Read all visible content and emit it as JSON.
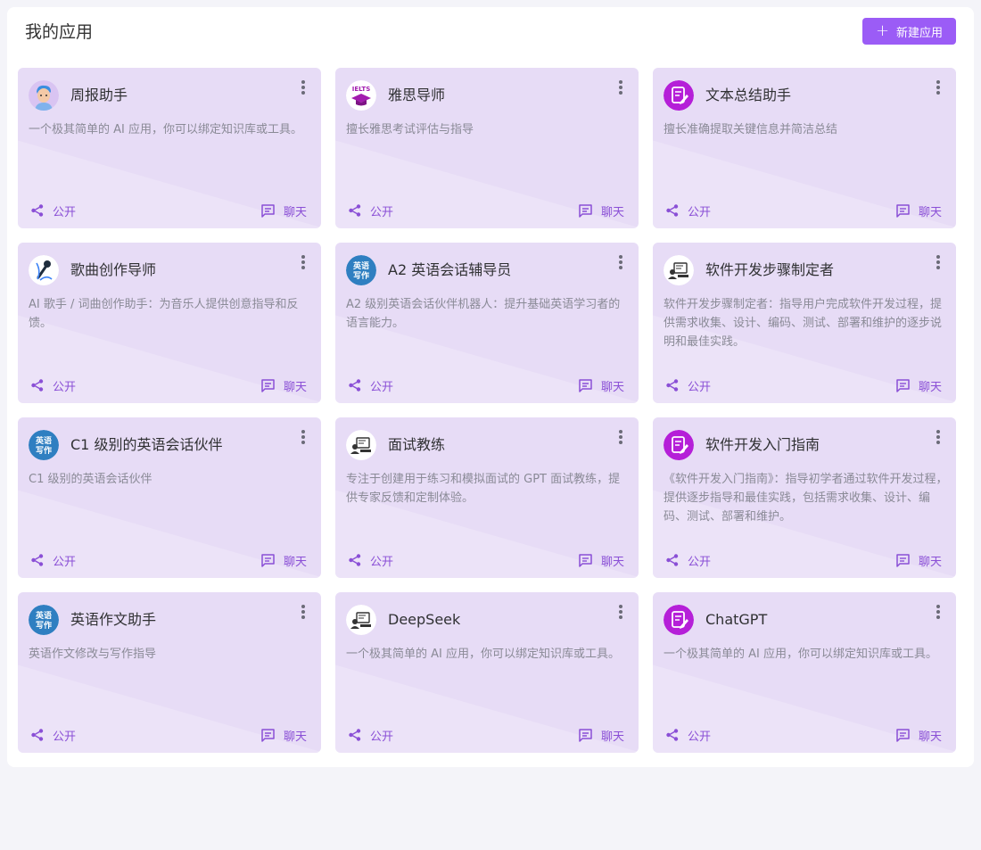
{
  "header": {
    "title": "我的应用",
    "new_button_label": "新建应用",
    "new_button_icon": "plus-icon"
  },
  "colors": {
    "accent": "#9b5cf6",
    "card_bg": "#e7dcf6",
    "action_text": "#8a4fd6"
  },
  "cards": [
    {
      "title": "周报助手",
      "description": "一个极其简单的 AI 应用，你可以绑定知识库或工具。",
      "avatar": "person-avatar",
      "public_label": "公开",
      "chat_label": "聊天"
    },
    {
      "title": "雅思导师",
      "description": "擅长雅思考试评估与指导",
      "avatar": "ielts-avatar",
      "avatar_text": "IELTS",
      "public_label": "公开",
      "chat_label": "聊天"
    },
    {
      "title": "文本总结助手",
      "description": "擅长准确提取关键信息并简洁总结",
      "avatar": "document-edit-avatar",
      "public_label": "公开",
      "chat_label": "聊天"
    },
    {
      "title": "歌曲创作导师",
      "description": "AI 歌手 / 词曲创作助手：为音乐人提供创意指导和反馈。",
      "avatar": "microphone-avatar",
      "public_label": "公开",
      "chat_label": "聊天"
    },
    {
      "title": "A2 英语会话辅导员",
      "description": "A2 级别英语会话伙伴机器人：提升基础英语学习者的语言能力。",
      "avatar": "english-writing-avatar",
      "avatar_text": "英语写作",
      "public_label": "公开",
      "chat_label": "聊天"
    },
    {
      "title": "软件开发步骤制定者",
      "description": "软件开发步骤制定者：指导用户完成软件开发过程，提供需求收集、设计、编码、测试、部署和维护的逐步说明和最佳实践。",
      "avatar": "interview-avatar",
      "public_label": "公开",
      "chat_label": "聊天"
    },
    {
      "title": "C1 级别的英语会话伙伴",
      "description": "C1 级别的英语会话伙伴",
      "avatar": "english-writing-avatar",
      "avatar_text": "英语写作",
      "public_label": "公开",
      "chat_label": "聊天"
    },
    {
      "title": "面试教练",
      "description": "专注于创建用于练习和模拟面试的 GPT 面试教练，提供专家反馈和定制体验。",
      "avatar": "interview-avatar",
      "public_label": "公开",
      "chat_label": "聊天"
    },
    {
      "title": "软件开发入门指南",
      "description": "《软件开发入门指南》：指导初学者通过软件开发过程，提供逐步指导和最佳实践，包括需求收集、设计、编码、测试、部署和维护。",
      "avatar": "document-edit-avatar",
      "public_label": "公开",
      "chat_label": "聊天"
    },
    {
      "title": "英语作文助手",
      "description": "英语作文修改与写作指导",
      "avatar": "english-writing-avatar",
      "avatar_text": "英语写作",
      "public_label": "公开",
      "chat_label": "聊天"
    },
    {
      "title": "DeepSeek",
      "description": "一个极其简单的 AI 应用，你可以绑定知识库或工具。",
      "avatar": "interview-avatar",
      "public_label": "公开",
      "chat_label": "聊天"
    },
    {
      "title": "ChatGPT",
      "description": "一个极其简单的 AI 应用，你可以绑定知识库或工具。",
      "avatar": "document-edit-avatar",
      "public_label": "公开",
      "chat_label": "聊天"
    }
  ]
}
